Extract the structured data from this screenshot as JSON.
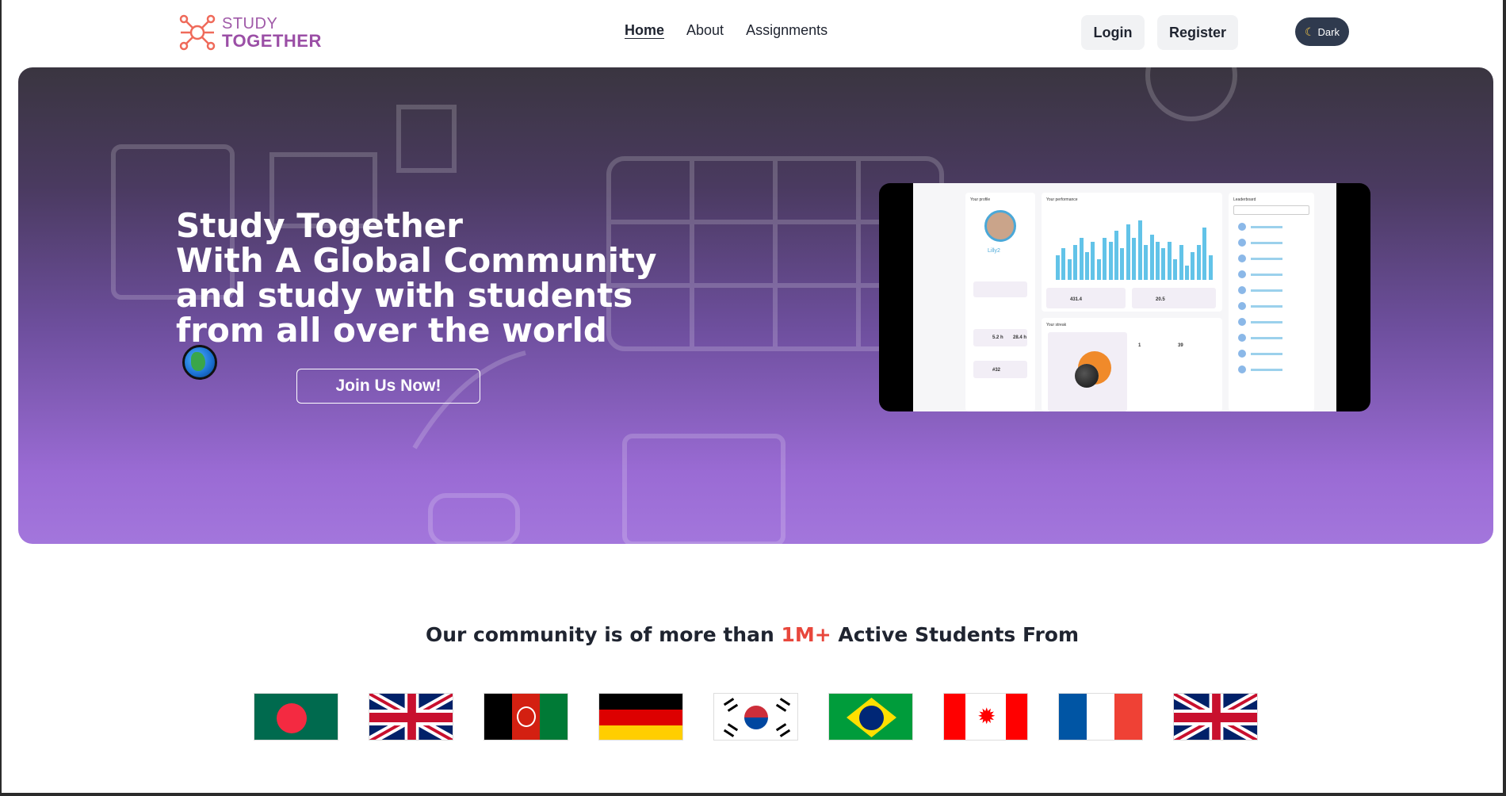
{
  "logo": {
    "line1": "STUDY",
    "line2": "TOGETHER"
  },
  "nav": {
    "links": [
      {
        "label": "Home",
        "active": true
      },
      {
        "label": "About",
        "active": false
      },
      {
        "label": "Assignments",
        "active": false
      }
    ],
    "login_label": "Login",
    "register_label": "Register",
    "theme_toggle_label": "Dark",
    "theme_toggle_icon": "moon-icon"
  },
  "hero": {
    "title_lines": [
      "Study Together",
      "With A Global Community",
      "and study with students",
      "from all over the world"
    ],
    "title_icon": "globe-icon",
    "cta_label": "Join Us Now!"
  },
  "preview": {
    "profile_label": "Your profile",
    "username": "Lilly2",
    "performance_label": "Your performance",
    "leaderboard_label": "Leaderboard",
    "stat1": "5.2 h",
    "stat2": "28.4 h",
    "rank": "#32",
    "total": "431.4",
    "avg": "20.5",
    "streak_label": "Your streak",
    "streak1": "1",
    "streak2": "39",
    "bars": [
      0.35,
      0.45,
      0.3,
      0.5,
      0.6,
      0.4,
      0.55,
      0.3,
      0.6,
      0.55,
      0.7,
      0.45,
      0.8,
      0.6,
      0.85,
      0.5,
      0.65,
      0.55,
      0.45,
      0.55,
      0.3,
      0.5,
      0.2,
      0.4,
      0.5,
      0.75,
      0.35
    ]
  },
  "community": {
    "prefix": "Our community is of more than ",
    "highlight": "1M+",
    "suffix": " Active Students From"
  },
  "flags": [
    "bangladesh",
    "united-kingdom",
    "afghanistan",
    "germany",
    "south-korea",
    "brazil",
    "canada",
    "france",
    "united-kingdom"
  ],
  "colors": {
    "accent": "#e8473c",
    "logo": "#9b4fa6",
    "hero_bottom": "#a376dc"
  }
}
